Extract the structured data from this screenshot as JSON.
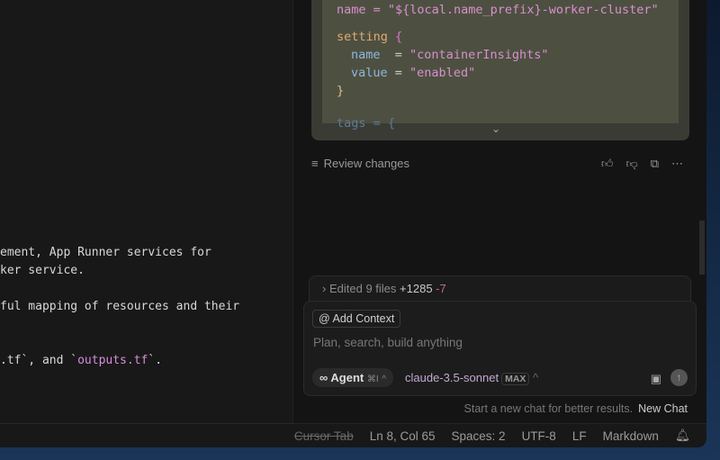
{
  "editor": {
    "lines": [
      "ement, App Runner services for",
      "ker service.",
      "ful mapping of resources and their",
      ".tf`, and `outputs.tf`."
    ],
    "l4_pre": ".tf`, and `",
    "l4_code": "outputs.tf",
    "l4_post": "`."
  },
  "code": {
    "l0": "name = \"${local.name_prefix}-worker-cluster\"",
    "kw": "setting",
    "ob": "{",
    "n1": "name",
    "v1": "\"containerInsights\"",
    "n2": "value",
    "v2": "\"enabled\"",
    "cb": "}",
    "tags": "tags = {",
    "eq1": "  =",
    "eq2": " ="
  },
  "chat": {
    "review": "Review changes",
    "edited": "Edited 9 files",
    "added": "+1285",
    "removed": "-7",
    "add_context": "Add Context",
    "placeholder": "Plan, search, build anything",
    "agent": "Agent",
    "agent_shortcut": "⌘I",
    "model": "claude-3.5-sonnet",
    "max": "MAX",
    "hint": "Start a new chat for better results.",
    "new_chat": "New Chat"
  },
  "status": {
    "cursor_tab": "Cursor Tab",
    "position": "Ln 8, Col 65",
    "spaces": "Spaces: 2",
    "encoding": "UTF-8",
    "eol": "LF",
    "language": "Markdown"
  }
}
